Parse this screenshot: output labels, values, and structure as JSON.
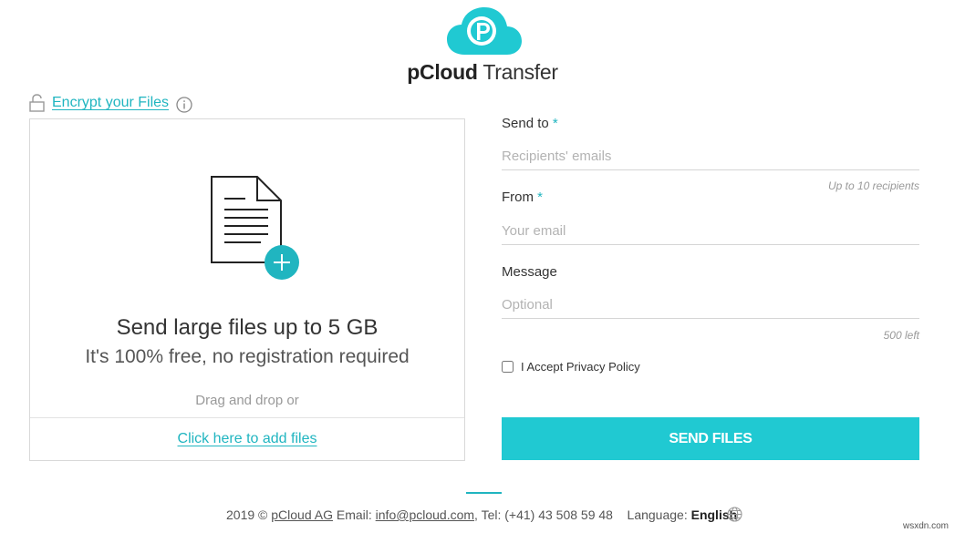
{
  "header": {
    "brand_bold": "pCloud",
    "brand_light": " Transfer",
    "logo_icon": "pcloud-cloud-logo",
    "accent_color": "#20c9d2"
  },
  "encrypt": {
    "label": "Encrypt your Files",
    "lock_icon": "unlock-icon",
    "info_icon": "info-icon"
  },
  "dropzone": {
    "icon": "document-add-icon",
    "title": "Send large files up to 5 GB",
    "subtitle": "It's 100% free, no registration required",
    "drag_hint": "Drag and drop or",
    "add_link": "Click here to add files"
  },
  "form": {
    "send_to": {
      "label": "Send to",
      "required": "*",
      "placeholder": "Recipients' emails",
      "value": "",
      "hint": "Up to 10 recipients"
    },
    "from": {
      "label": "From",
      "required": "*",
      "placeholder": "Your email",
      "value": ""
    },
    "message": {
      "label": "Message",
      "placeholder": "Optional",
      "value": "",
      "hint": "500 left"
    },
    "privacy": {
      "label": "I Accept Privacy Policy",
      "checked": false
    },
    "submit_label": "SEND FILES"
  },
  "footer": {
    "copyright": "2019 ©",
    "company": "pCloud AG",
    "email_label": "Email:",
    "email": "info@pcloud.com",
    "tel": ", Tel: (+41) 43 508 59 48",
    "language_label": "Language:",
    "language": "English",
    "globe_icon": "globe-icon"
  },
  "watermark": "wsxdn.com"
}
